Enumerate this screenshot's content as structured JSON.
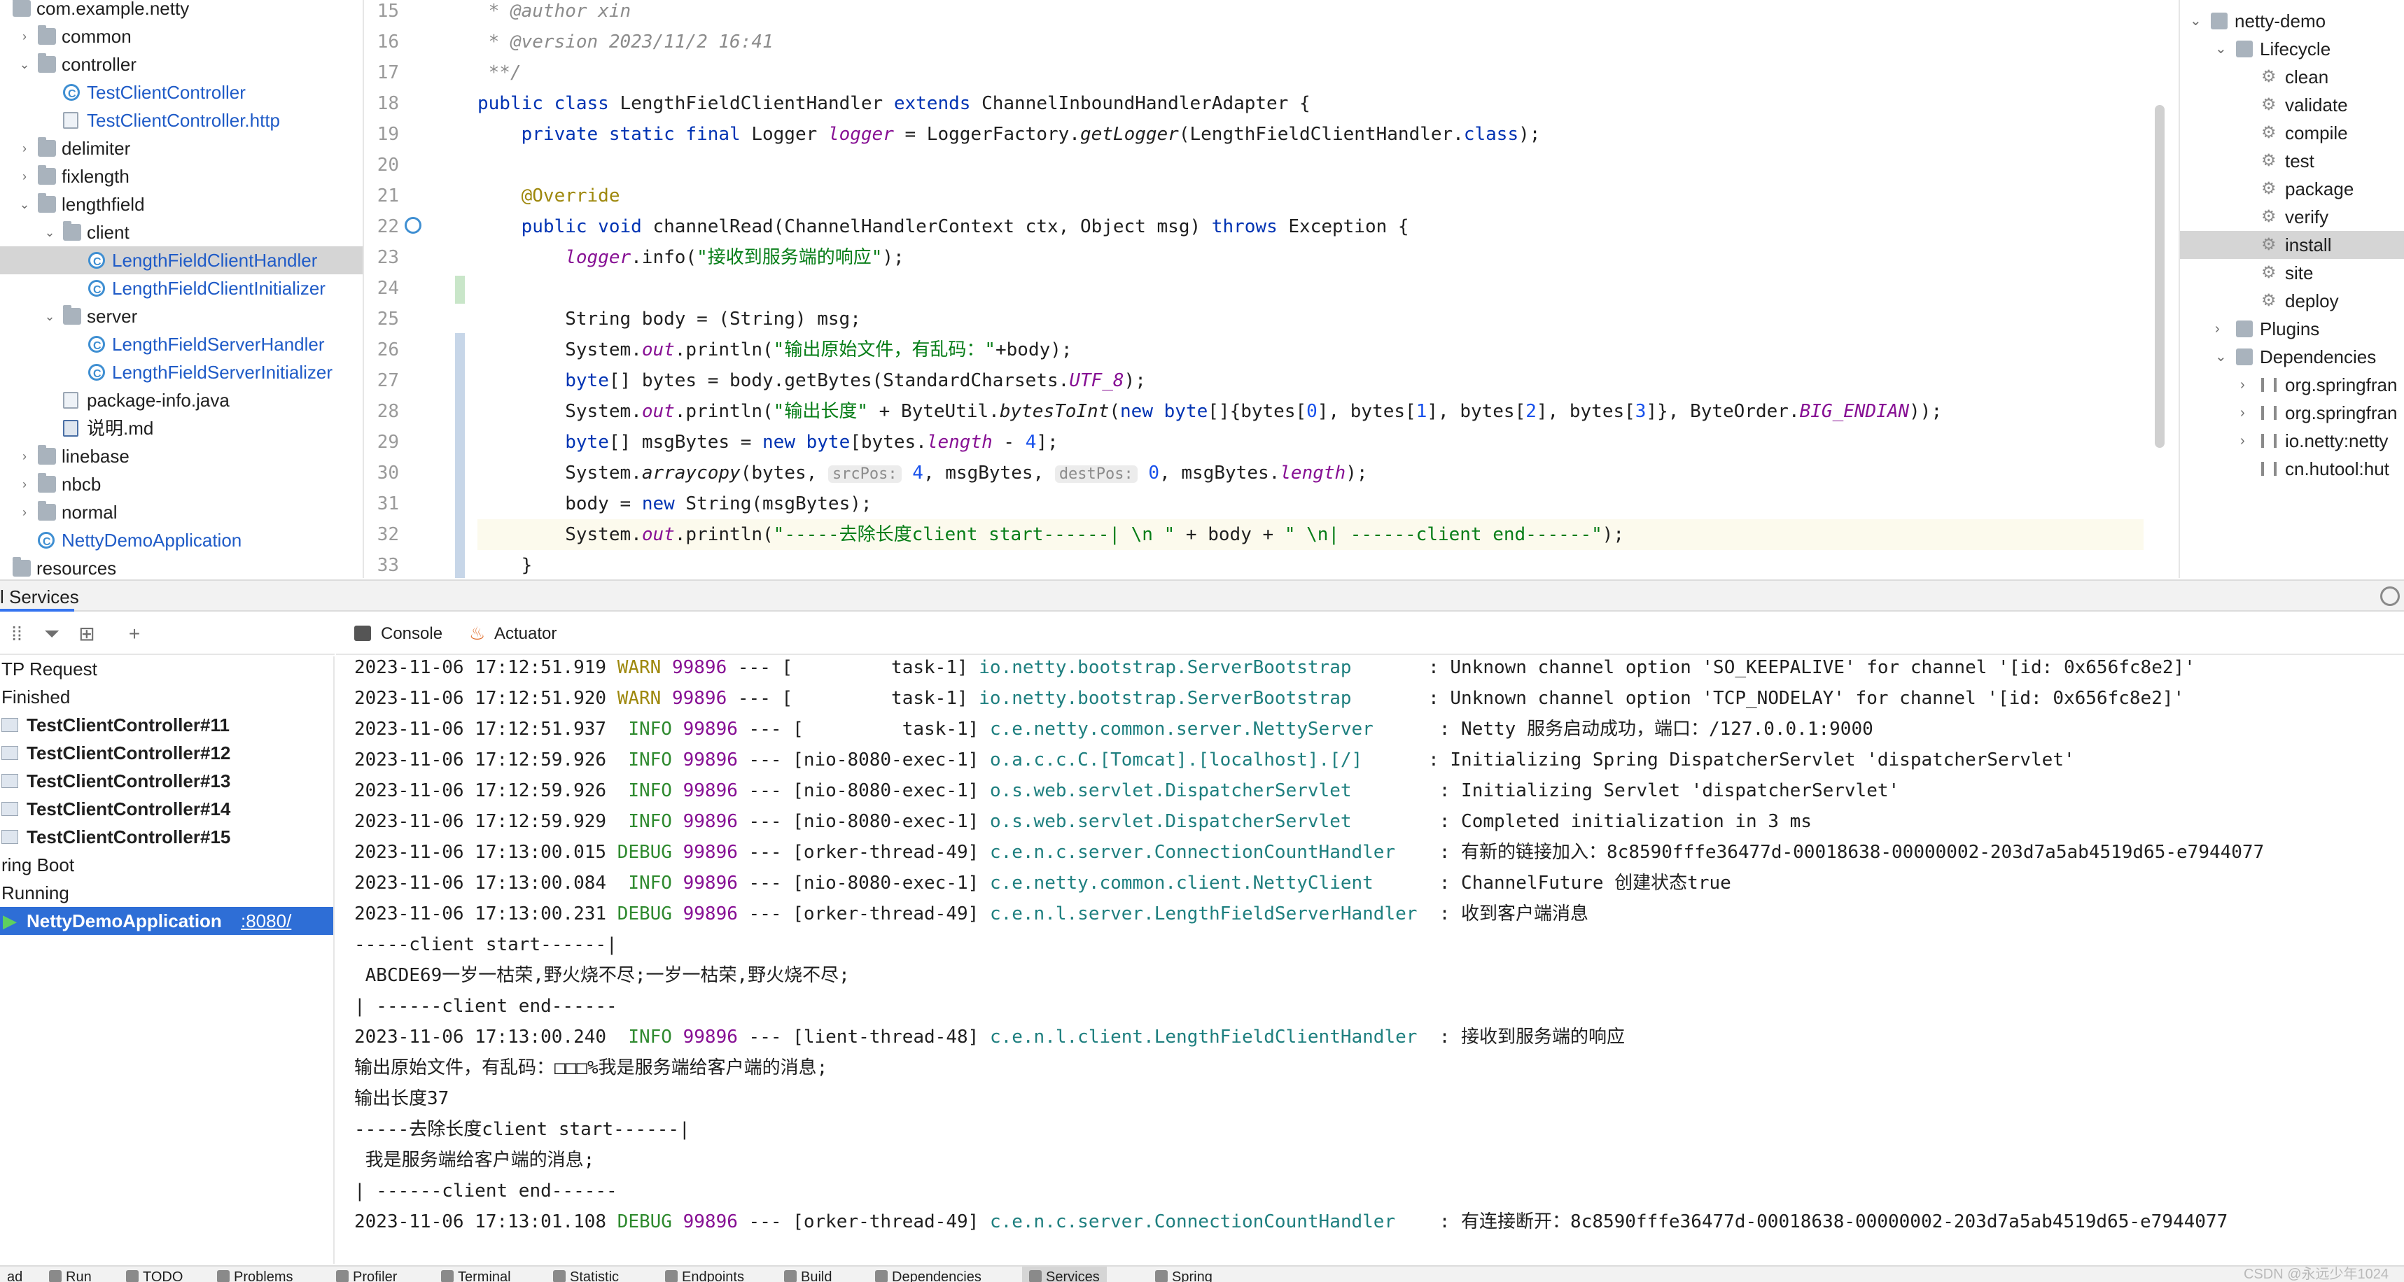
{
  "project_tree": {
    "items": [
      {
        "label": "com.example.netty",
        "kind": "package"
      },
      {
        "label": "common",
        "kind": "folder"
      },
      {
        "label": "controller",
        "kind": "folder"
      },
      {
        "label": "TestClientController",
        "kind": "class"
      },
      {
        "label": "TestClientController.http",
        "kind": "http"
      },
      {
        "label": "delimiter",
        "kind": "folder"
      },
      {
        "label": "fixlength",
        "kind": "folder"
      },
      {
        "label": "lengthfield",
        "kind": "folder"
      },
      {
        "label": "client",
        "kind": "folder"
      },
      {
        "label": "LengthFieldClientHandler",
        "kind": "class",
        "selected": true
      },
      {
        "label": "LengthFieldClientInitializer",
        "kind": "class"
      },
      {
        "label": "server",
        "kind": "folder"
      },
      {
        "label": "LengthFieldServerHandler",
        "kind": "class"
      },
      {
        "label": "LengthFieldServerInitializer",
        "kind": "class"
      },
      {
        "label": "package-info.java",
        "kind": "file"
      },
      {
        "label": "说明.md",
        "kind": "md"
      },
      {
        "label": "linebase",
        "kind": "folder"
      },
      {
        "label": "nbcb",
        "kind": "folder"
      },
      {
        "label": "normal",
        "kind": "folder"
      },
      {
        "label": "NettyDemoApplication",
        "kind": "class"
      },
      {
        "label": "resources",
        "kind": "folder"
      }
    ]
  },
  "editor": {
    "line_numbers": [
      "15",
      "16",
      "17",
      "18",
      "19",
      "20",
      "21",
      "22",
      "23",
      "24",
      "25",
      "26",
      "27",
      "28",
      "29",
      "30",
      "31",
      "32",
      "33"
    ],
    "lines": {
      "l15_a": " * ",
      "l15_b": "@author",
      "l15_c": " xin",
      "l16_a": " * ",
      "l16_b": "@version",
      "l16_c": " 2023/11/2 16:41",
      "l17": " **/",
      "l18_a": "public class",
      "l18_b": " LengthFieldClientHandler ",
      "l18_c": "extends",
      "l18_d": " ChannelInboundHandlerAdapter {",
      "l19_a": "    private static final",
      "l19_b": " Logger ",
      "l19_c": "logger",
      "l19_d": " = LoggerFactory.",
      "l19_e": "getLogger",
      "l19_f": "(LengthFieldClientHandler.",
      "l19_g": "class",
      "l19_h": ");",
      "l21": "    @Override",
      "l22_a": "    public void",
      "l22_b": " channelRead(ChannelHandlerContext ctx, Object msg) ",
      "l22_c": "throws",
      "l22_d": " Exception {",
      "l23_a": "        ",
      "l23_b": "logger",
      "l23_c": ".info(",
      "l23_d": "\"接收到服务端的响应\"",
      "l23_e": ");",
      "l25": "        String body = (String) msg;",
      "l26_a": "        System.",
      "l26_b": "out",
      "l26_c": ".println(",
      "l26_d": "\"输出原始文件，有乱码：\"",
      "l26_e": "+body);",
      "l27_a": "        ",
      "l27_b": "byte",
      "l27_c": "[] bytes = body.getBytes(StandardCharsets.",
      "l27_d": "UTF_8",
      "l27_e": ");",
      "l28_a": "        System.",
      "l28_b": "out",
      "l28_c": ".println(",
      "l28_d": "\"输出长度\"",
      "l28_e": " + ByteUtil.",
      "l28_f": "bytesToInt",
      "l28_g": "(",
      "l28_h": "new byte",
      "l28_i": "[]{bytes[",
      "l28_j": "0",
      "l28_k": "], bytes[",
      "l28_l": "1",
      "l28_m": "], bytes[",
      "l28_n": "2",
      "l28_o": "], bytes[",
      "l28_p": "3",
      "l28_q": "]}, ByteOrder.",
      "l28_r": "BIG_ENDIAN",
      "l28_s": "));",
      "l29_a": "        ",
      "l29_b": "byte",
      "l29_c": "[] msgBytes = ",
      "l29_d": "new byte",
      "l29_e": "[bytes.",
      "l29_f": "length",
      "l29_g": " - ",
      "l29_h": "4",
      "l29_i": "];",
      "l30_a": "        System.",
      "l30_b": "arraycopy",
      "l30_c": "(bytes, ",
      "l30_d": "srcPos:",
      "l30_e": " 4",
      "l30_f": ", msgBytes, ",
      "l30_g": "destPos:",
      "l30_h": " 0",
      "l30_i": ", msgBytes.",
      "l30_j": "length",
      "l30_k": ");",
      "l31_a": "        body = ",
      "l31_b": "new",
      "l31_c": " String(msgBytes);",
      "l32_a": "        System.",
      "l32_b": "out",
      "l32_c": ".println(",
      "l32_d": "\"-----去除长度client start------| \\n \"",
      "l32_e": " + body + ",
      "l32_f": "\" \\n| ------client end------\"",
      "l32_g": ");",
      "l33": "    }"
    }
  },
  "maven": {
    "items": [
      {
        "label": "netty-demo"
      },
      {
        "label": "Lifecycle"
      },
      {
        "label": "clean"
      },
      {
        "label": "validate"
      },
      {
        "label": "compile"
      },
      {
        "label": "test"
      },
      {
        "label": "package"
      },
      {
        "label": "verify"
      },
      {
        "label": "install",
        "selected": true
      },
      {
        "label": "site"
      },
      {
        "label": "deploy"
      },
      {
        "label": "Plugins"
      },
      {
        "label": "Dependencies"
      },
      {
        "label": "org.springfran"
      },
      {
        "label": "org.springfran"
      },
      {
        "label": "io.netty:netty"
      },
      {
        "label": "cn.hutool:hut"
      }
    ]
  },
  "services": {
    "title": "l Services",
    "tree": [
      {
        "label": "TP Request",
        "bold": false
      },
      {
        "label": "Finished",
        "bold": false
      },
      {
        "label": "TestClientController#11",
        "bold": true
      },
      {
        "label": "TestClientController#12",
        "bold": true
      },
      {
        "label": "TestClientController#13",
        "bold": true
      },
      {
        "label": "TestClientController#14",
        "bold": true
      },
      {
        "label": "TestClientController#15",
        "bold": true
      },
      {
        "label": "ring Boot",
        "bold": false
      },
      {
        "label": "Running",
        "bold": false
      },
      {
        "label": "NettyDemoApplication",
        "port": ":8080/",
        "bold": true,
        "selected": true
      }
    ]
  },
  "console": {
    "tabs": [
      "Console",
      "Actuator"
    ],
    "log": [
      {
        "ts": "2023-11-06 17:12:51.919",
        "lvl": "WARN",
        "pid": "99896",
        "thread": " --- [         task-1] ",
        "logger": "io.netty.bootstrap.ServerBootstrap      ",
        "msg": " : Unknown channel option 'SO_KEEPALIVE' for channel '[id: 0x656fc8e2]'"
      },
      {
        "ts": "2023-11-06 17:12:51.920",
        "lvl": "WARN",
        "pid": "99896",
        "thread": " --- [         task-1] ",
        "logger": "io.netty.bootstrap.ServerBootstrap      ",
        "msg": " : Unknown channel option 'TCP_NODELAY' for channel '[id: 0x656fc8e2]'"
      },
      {
        "ts": "2023-11-06 17:12:51.937",
        "lvl": " INFO",
        "pid": "99896",
        "thread": " --- [         task-1] ",
        "logger": "c.e.netty.common.server.NettyServer     ",
        "msg": " : Netty 服务启动成功，端口：/127.0.0.1:9000"
      },
      {
        "ts": "2023-11-06 17:12:59.926",
        "lvl": " INFO",
        "pid": "99896",
        "thread": " --- [nio-8080-exec-1] ",
        "logger": "o.a.c.c.C.[Tomcat].[localhost].[/]     ",
        "msg": " : Initializing Spring DispatcherServlet 'dispatcherServlet'"
      },
      {
        "ts": "2023-11-06 17:12:59.926",
        "lvl": " INFO",
        "pid": "99896",
        "thread": " --- [nio-8080-exec-1] ",
        "logger": "o.s.web.servlet.DispatcherServlet       ",
        "msg": " : Initializing Servlet 'dispatcherServlet'"
      },
      {
        "ts": "2023-11-06 17:12:59.929",
        "lvl": " INFO",
        "pid": "99896",
        "thread": " --- [nio-8080-exec-1] ",
        "logger": "o.s.web.servlet.DispatcherServlet       ",
        "msg": " : Completed initialization in 3 ms"
      },
      {
        "ts": "2023-11-06 17:13:00.015",
        "lvl": "DEBUG",
        "pid": "99896",
        "thread": " --- [orker-thread-49] ",
        "logger": "c.e.n.c.server.ConnectionCountHandler   ",
        "msg": " : 有新的链接加入：8c8590fffe36477d-00018638-00000002-203d7a5ab4519d65-e7944077"
      },
      {
        "ts": "2023-11-06 17:13:00.084",
        "lvl": " INFO",
        "pid": "99896",
        "thread": " --- [nio-8080-exec-1] ",
        "logger": "c.e.netty.common.client.NettyClient     ",
        "msg": " : ChannelFuture 创建状态true"
      },
      {
        "ts": "2023-11-06 17:13:00.231",
        "lvl": "DEBUG",
        "pid": "99896",
        "thread": " --- [orker-thread-49] ",
        "logger": "c.e.n.l.server.LengthFieldServerHandler ",
        "msg": " : 收到客户端消息"
      },
      {
        "plain": "-----client start------|"
      },
      {
        "plain": " ABCDE69一岁一枯荣,野火烧不尽;一岁一枯荣,野火烧不尽;"
      },
      {
        "plain": "| ------client end------"
      },
      {
        "ts": "2023-11-06 17:13:00.240",
        "lvl": " INFO",
        "pid": "99896",
        "thread": " --- [lient-thread-48] ",
        "logger": "c.e.n.l.client.LengthFieldClientHandler ",
        "msg": " : 接收到服务端的响应"
      },
      {
        "plain": "输出原始文件，有乱码：□□□%我是服务端给客户端的消息;"
      },
      {
        "plain": "输出长度37"
      },
      {
        "plain": "-----去除长度client start------|"
      },
      {
        "plain": " 我是服务端给客户端的消息;"
      },
      {
        "plain": "| ------client end------"
      },
      {
        "ts": "2023-11-06 17:13:01.108",
        "lvl": "DEBUG",
        "pid": "99896",
        "thread": " --- [orker-thread-49] ",
        "logger": "c.e.n.c.server.ConnectionCountHandler   ",
        "msg": " : 有连接断开：8c8590fffe36477d-00018638-00000002-203d7a5ab4519d65-e7944077"
      }
    ]
  },
  "bottom_tabs": [
    "ad",
    "Run",
    "TODO",
    "Problems",
    "Profiler",
    "Terminal",
    "Statistic",
    "Endpoints",
    "Build",
    "Dependencies",
    "Services",
    "Spring"
  ],
  "watermark": "CSDN @永远少年1024"
}
